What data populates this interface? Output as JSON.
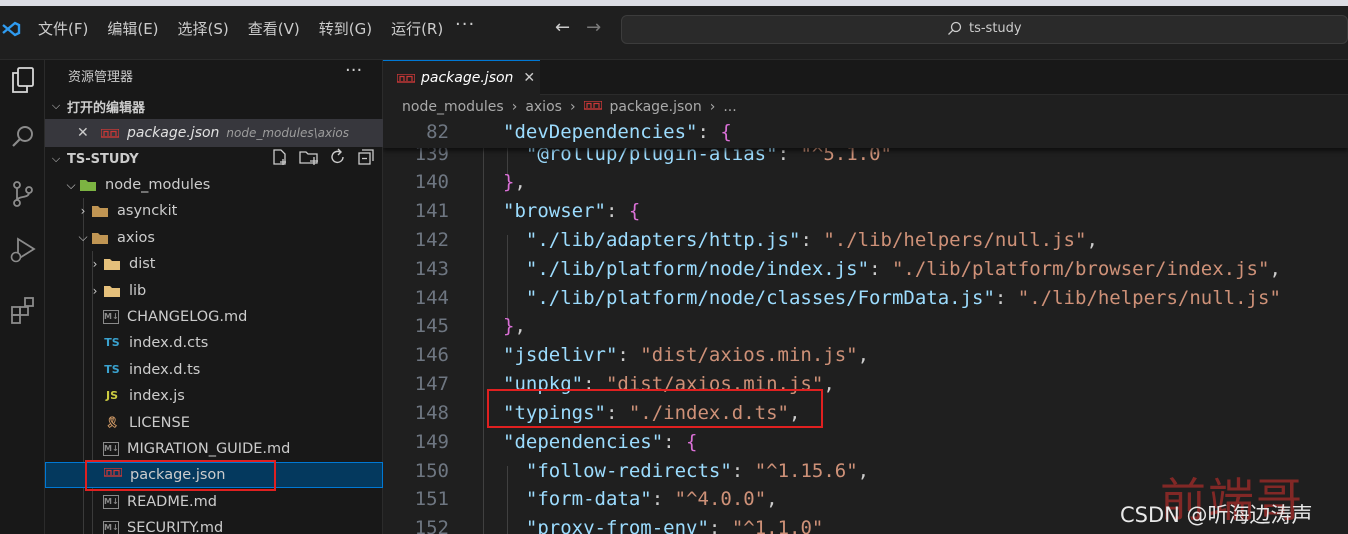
{
  "menu": [
    "文件(F)",
    "编辑(E)",
    "选择(S)",
    "查看(V)",
    "转到(G)",
    "运行(R)"
  ],
  "menu_more": "···",
  "search": {
    "text": "ts-study"
  },
  "activity": [
    "explorer-icon",
    "search-icon",
    "source-control-icon",
    "run-debug-icon",
    "extensions-icon"
  ],
  "sidebar": {
    "title": "资源管理器",
    "more": "···",
    "open_editors": {
      "label": "打开的编辑器",
      "items": [
        {
          "name": "package.json",
          "path": "node_modules\\axios"
        }
      ]
    },
    "workspace": "TS-STUDY",
    "tree": [
      {
        "name": "node_modules",
        "type": "folder-open",
        "icon_color": "#7cb342",
        "level": 1
      },
      {
        "name": "asynckit",
        "type": "folder",
        "icon_color": "#c09553",
        "level": 2
      },
      {
        "name": "axios",
        "type": "folder-open",
        "icon_color": "#c09553",
        "level": 2
      },
      {
        "name": "dist",
        "type": "folder",
        "icon_color": "#e5c07b",
        "level": 3
      },
      {
        "name": "lib",
        "type": "folder",
        "icon_color": "#e5c07b",
        "level": 3
      },
      {
        "name": "CHANGELOG.md",
        "type": "file",
        "badge": "M↓",
        "icon_color": "#8a8a8a",
        "level": 3
      },
      {
        "name": "index.d.cts",
        "type": "file",
        "badge": "TS",
        "icon_color": "#3aa2cf",
        "level": 3
      },
      {
        "name": "index.d.ts",
        "type": "file",
        "badge": "TS",
        "icon_color": "#3aa2cf",
        "level": 3
      },
      {
        "name": "index.js",
        "type": "file",
        "badge": "JS",
        "icon_color": "#cbcb41",
        "level": 3
      },
      {
        "name": "LICENSE",
        "type": "file",
        "badge": "🎗",
        "icon_color": "#d19a66",
        "level": 3
      },
      {
        "name": "MIGRATION_GUIDE.md",
        "type": "file",
        "badge": "M↓",
        "icon_color": "#8a8a8a",
        "level": 3
      },
      {
        "name": "package.json",
        "type": "file",
        "badge": "npm",
        "icon_color": "#cb3837",
        "level": 3,
        "selected": true
      },
      {
        "name": "README.md",
        "type": "file",
        "badge": "M↓",
        "icon_color": "#8a8a8a",
        "level": 3
      },
      {
        "name": "SECURITY.md",
        "type": "file",
        "badge": "M↓",
        "icon_color": "#8a8a8a",
        "level": 3
      }
    ]
  },
  "tab": {
    "name": "package.json",
    "close": "✕"
  },
  "breadcrumb": [
    "node_modules",
    "axios",
    "package.json",
    "..."
  ],
  "sticky_line": {
    "number": "82",
    "code": [
      [
        "k",
        "\"devDependencies\""
      ],
      [
        "t",
        ": "
      ],
      [
        "p1",
        "{"
      ]
    ]
  },
  "lines": [
    {
      "n": "139",
      "indent": 2,
      "code": [
        [
          "k",
          "\"@rollup/plugin-alias\""
        ],
        [
          "t",
          ": "
        ],
        [
          "s",
          "\"^5.1.0\""
        ]
      ]
    },
    {
      "n": "140",
      "indent": 1,
      "code": [
        [
          "p1",
          "}"
        ],
        [
          "t",
          ","
        ]
      ]
    },
    {
      "n": "141",
      "indent": 1,
      "code": [
        [
          "k",
          "\"browser\""
        ],
        [
          "t",
          ": "
        ],
        [
          "p1",
          "{"
        ]
      ]
    },
    {
      "n": "142",
      "indent": 2,
      "code": [
        [
          "k",
          "\"./lib/adapters/http.js\""
        ],
        [
          "t",
          ": "
        ],
        [
          "s",
          "\"./lib/helpers/null.js\""
        ],
        [
          "t",
          ","
        ]
      ]
    },
    {
      "n": "143",
      "indent": 2,
      "code": [
        [
          "k",
          "\"./lib/platform/node/index.js\""
        ],
        [
          "t",
          ": "
        ],
        [
          "s",
          "\"./lib/platform/browser/index.js\""
        ],
        [
          "t",
          ","
        ]
      ]
    },
    {
      "n": "144",
      "indent": 2,
      "code": [
        [
          "k",
          "\"./lib/platform/node/classes/FormData.js\""
        ],
        [
          "t",
          ": "
        ],
        [
          "s",
          "\"./lib/helpers/null.js\""
        ]
      ]
    },
    {
      "n": "145",
      "indent": 1,
      "code": [
        [
          "p1",
          "}"
        ],
        [
          "t",
          ","
        ]
      ]
    },
    {
      "n": "146",
      "indent": 1,
      "code": [
        [
          "k",
          "\"jsdelivr\""
        ],
        [
          "t",
          ": "
        ],
        [
          "s",
          "\"dist/axios.min.js\""
        ],
        [
          "t",
          ","
        ]
      ]
    },
    {
      "n": "147",
      "indent": 1,
      "code": [
        [
          "k",
          "\"unpkg\""
        ],
        [
          "t",
          ": "
        ],
        [
          "s",
          "\"dist/axios.min.js\""
        ],
        [
          "t",
          ","
        ]
      ]
    },
    {
      "n": "148",
      "indent": 1,
      "code": [
        [
          "k",
          "\"typings\""
        ],
        [
          "t",
          ": "
        ],
        [
          "s",
          "\"./index.d.ts\""
        ],
        [
          "t",
          ","
        ]
      ]
    },
    {
      "n": "149",
      "indent": 1,
      "code": [
        [
          "k",
          "\"dependencies\""
        ],
        [
          "t",
          ": "
        ],
        [
          "p1",
          "{"
        ]
      ]
    },
    {
      "n": "150",
      "indent": 2,
      "code": [
        [
          "k",
          "\"follow-redirects\""
        ],
        [
          "t",
          ": "
        ],
        [
          "s",
          "\"^1.15.6\""
        ],
        [
          "t",
          ","
        ]
      ]
    },
    {
      "n": "151",
      "indent": 2,
      "code": [
        [
          "k",
          "\"form-data\""
        ],
        [
          "t",
          ": "
        ],
        [
          "s",
          "\"^4.0.0\""
        ],
        [
          "t",
          ","
        ]
      ]
    },
    {
      "n": "152",
      "indent": 2,
      "code": [
        [
          "k",
          "\"proxy-from-env\""
        ],
        [
          "t",
          ": "
        ],
        [
          "s",
          "\"^1.1.0\""
        ]
      ]
    }
  ],
  "watermark": "前端哥",
  "credit": "CSDN @听海边涛声"
}
